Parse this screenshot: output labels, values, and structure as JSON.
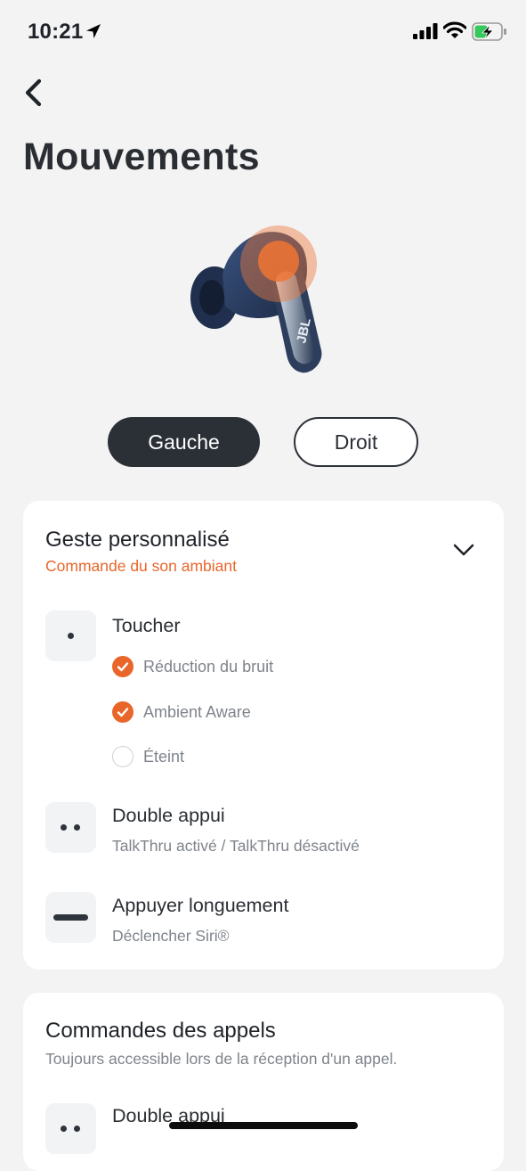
{
  "status_bar": {
    "time": "10:21"
  },
  "header": {
    "title": "Mouvements"
  },
  "earbud_toggle": {
    "left": "Gauche",
    "right": "Droit",
    "selected": "Gauche"
  },
  "custom_gesture": {
    "title": "Geste personnalisé",
    "subtitle": "Commande du son ambiant",
    "gestures": [
      {
        "title": "Toucher",
        "options": [
          {
            "label": "Réduction du bruit",
            "checked": true
          },
          {
            "label": "Ambient Aware",
            "checked": true
          },
          {
            "label": "Éteint",
            "checked": false
          }
        ]
      },
      {
        "title": "Double appui",
        "description": "TalkThru activé / TalkThru désactivé"
      },
      {
        "title": "Appuyer longuement",
        "description": "Déclencher Siri®"
      }
    ]
  },
  "call_controls": {
    "title": "Commandes des appels",
    "subtitle": "Toujours accessible lors de la réception d'un appel.",
    "gestures": [
      {
        "title": "Double appui"
      }
    ]
  },
  "colors": {
    "accent": "#e9662a",
    "dark": "#2b3037",
    "background": "#f3f3f4"
  }
}
